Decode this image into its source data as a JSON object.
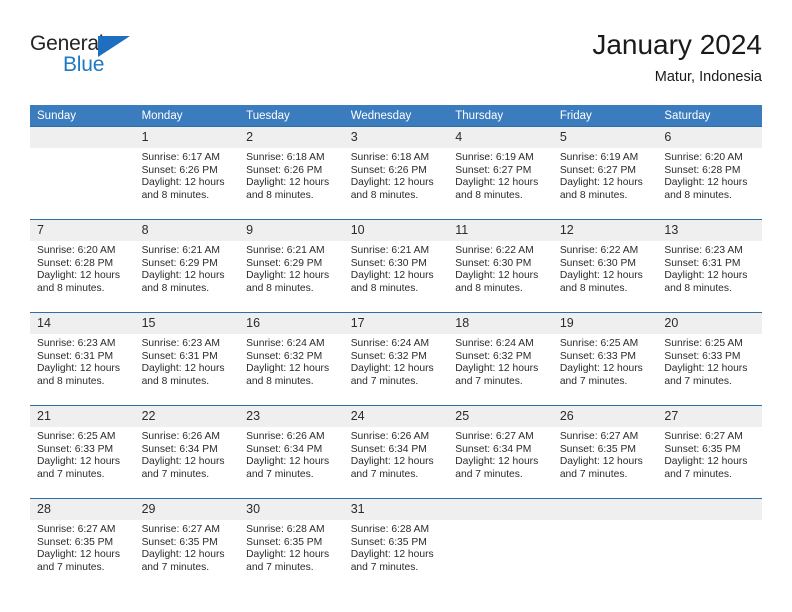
{
  "brand": {
    "name_part1": "General",
    "name_part2": "Blue",
    "triangle_color": "#1f6fc0",
    "text_color": "#242424",
    "blue_color": "#2079c4"
  },
  "header": {
    "title": "January 2024",
    "subtitle": "Matur, Indonesia"
  },
  "theme": {
    "header_row_bg": "#3a7cbe",
    "header_row_text": "#ffffff",
    "row_divider": "#2f6ca8",
    "daynum_bg": "#efefef",
    "cell_bg": "#ffffff",
    "body_text": "#2b2b2b"
  },
  "weekdays": [
    "Sunday",
    "Monday",
    "Tuesday",
    "Wednesday",
    "Thursday",
    "Friday",
    "Saturday"
  ],
  "labels": {
    "sunrise_prefix": "Sunrise:",
    "sunset_prefix": "Sunset:",
    "daylight_prefix": "Daylight:"
  },
  "weeks": [
    [
      {
        "day": "",
        "empty": true
      },
      {
        "day": "1",
        "line1": "Sunrise: 6:17 AM",
        "line2": "Sunset: 6:26 PM",
        "line3": "Daylight: 12 hours",
        "line4": "and 8 minutes."
      },
      {
        "day": "2",
        "line1": "Sunrise: 6:18 AM",
        "line2": "Sunset: 6:26 PM",
        "line3": "Daylight: 12 hours",
        "line4": "and 8 minutes."
      },
      {
        "day": "3",
        "line1": "Sunrise: 6:18 AM",
        "line2": "Sunset: 6:26 PM",
        "line3": "Daylight: 12 hours",
        "line4": "and 8 minutes."
      },
      {
        "day": "4",
        "line1": "Sunrise: 6:19 AM",
        "line2": "Sunset: 6:27 PM",
        "line3": "Daylight: 12 hours",
        "line4": "and 8 minutes."
      },
      {
        "day": "5",
        "line1": "Sunrise: 6:19 AM",
        "line2": "Sunset: 6:27 PM",
        "line3": "Daylight: 12 hours",
        "line4": "and 8 minutes."
      },
      {
        "day": "6",
        "line1": "Sunrise: 6:20 AM",
        "line2": "Sunset: 6:28 PM",
        "line3": "Daylight: 12 hours",
        "line4": "and 8 minutes."
      }
    ],
    [
      {
        "day": "7",
        "line1": "Sunrise: 6:20 AM",
        "line2": "Sunset: 6:28 PM",
        "line3": "Daylight: 12 hours",
        "line4": "and 8 minutes."
      },
      {
        "day": "8",
        "line1": "Sunrise: 6:21 AM",
        "line2": "Sunset: 6:29 PM",
        "line3": "Daylight: 12 hours",
        "line4": "and 8 minutes."
      },
      {
        "day": "9",
        "line1": "Sunrise: 6:21 AM",
        "line2": "Sunset: 6:29 PM",
        "line3": "Daylight: 12 hours",
        "line4": "and 8 minutes."
      },
      {
        "day": "10",
        "line1": "Sunrise: 6:21 AM",
        "line2": "Sunset: 6:30 PM",
        "line3": "Daylight: 12 hours",
        "line4": "and 8 minutes."
      },
      {
        "day": "11",
        "line1": "Sunrise: 6:22 AM",
        "line2": "Sunset: 6:30 PM",
        "line3": "Daylight: 12 hours",
        "line4": "and 8 minutes."
      },
      {
        "day": "12",
        "line1": "Sunrise: 6:22 AM",
        "line2": "Sunset: 6:30 PM",
        "line3": "Daylight: 12 hours",
        "line4": "and 8 minutes."
      },
      {
        "day": "13",
        "line1": "Sunrise: 6:23 AM",
        "line2": "Sunset: 6:31 PM",
        "line3": "Daylight: 12 hours",
        "line4": "and 8 minutes."
      }
    ],
    [
      {
        "day": "14",
        "line1": "Sunrise: 6:23 AM",
        "line2": "Sunset: 6:31 PM",
        "line3": "Daylight: 12 hours",
        "line4": "and 8 minutes."
      },
      {
        "day": "15",
        "line1": "Sunrise: 6:23 AM",
        "line2": "Sunset: 6:31 PM",
        "line3": "Daylight: 12 hours",
        "line4": "and 8 minutes."
      },
      {
        "day": "16",
        "line1": "Sunrise: 6:24 AM",
        "line2": "Sunset: 6:32 PM",
        "line3": "Daylight: 12 hours",
        "line4": "and 8 minutes."
      },
      {
        "day": "17",
        "line1": "Sunrise: 6:24 AM",
        "line2": "Sunset: 6:32 PM",
        "line3": "Daylight: 12 hours",
        "line4": "and 7 minutes."
      },
      {
        "day": "18",
        "line1": "Sunrise: 6:24 AM",
        "line2": "Sunset: 6:32 PM",
        "line3": "Daylight: 12 hours",
        "line4": "and 7 minutes."
      },
      {
        "day": "19",
        "line1": "Sunrise: 6:25 AM",
        "line2": "Sunset: 6:33 PM",
        "line3": "Daylight: 12 hours",
        "line4": "and 7 minutes."
      },
      {
        "day": "20",
        "line1": "Sunrise: 6:25 AM",
        "line2": "Sunset: 6:33 PM",
        "line3": "Daylight: 12 hours",
        "line4": "and 7 minutes."
      }
    ],
    [
      {
        "day": "21",
        "line1": "Sunrise: 6:25 AM",
        "line2": "Sunset: 6:33 PM",
        "line3": "Daylight: 12 hours",
        "line4": "and 7 minutes."
      },
      {
        "day": "22",
        "line1": "Sunrise: 6:26 AM",
        "line2": "Sunset: 6:34 PM",
        "line3": "Daylight: 12 hours",
        "line4": "and 7 minutes."
      },
      {
        "day": "23",
        "line1": "Sunrise: 6:26 AM",
        "line2": "Sunset: 6:34 PM",
        "line3": "Daylight: 12 hours",
        "line4": "and 7 minutes."
      },
      {
        "day": "24",
        "line1": "Sunrise: 6:26 AM",
        "line2": "Sunset: 6:34 PM",
        "line3": "Daylight: 12 hours",
        "line4": "and 7 minutes."
      },
      {
        "day": "25",
        "line1": "Sunrise: 6:27 AM",
        "line2": "Sunset: 6:34 PM",
        "line3": "Daylight: 12 hours",
        "line4": "and 7 minutes."
      },
      {
        "day": "26",
        "line1": "Sunrise: 6:27 AM",
        "line2": "Sunset: 6:35 PM",
        "line3": "Daylight: 12 hours",
        "line4": "and 7 minutes."
      },
      {
        "day": "27",
        "line1": "Sunrise: 6:27 AM",
        "line2": "Sunset: 6:35 PM",
        "line3": "Daylight: 12 hours",
        "line4": "and 7 minutes."
      }
    ],
    [
      {
        "day": "28",
        "line1": "Sunrise: 6:27 AM",
        "line2": "Sunset: 6:35 PM",
        "line3": "Daylight: 12 hours",
        "line4": "and 7 minutes."
      },
      {
        "day": "29",
        "line1": "Sunrise: 6:27 AM",
        "line2": "Sunset: 6:35 PM",
        "line3": "Daylight: 12 hours",
        "line4": "and 7 minutes."
      },
      {
        "day": "30",
        "line1": "Sunrise: 6:28 AM",
        "line2": "Sunset: 6:35 PM",
        "line3": "Daylight: 12 hours",
        "line4": "and 7 minutes."
      },
      {
        "day": "31",
        "line1": "Sunrise: 6:28 AM",
        "line2": "Sunset: 6:35 PM",
        "line3": "Daylight: 12 hours",
        "line4": "and 7 minutes."
      },
      {
        "day": "",
        "empty": true
      },
      {
        "day": "",
        "empty": true
      },
      {
        "day": "",
        "empty": true
      }
    ]
  ]
}
